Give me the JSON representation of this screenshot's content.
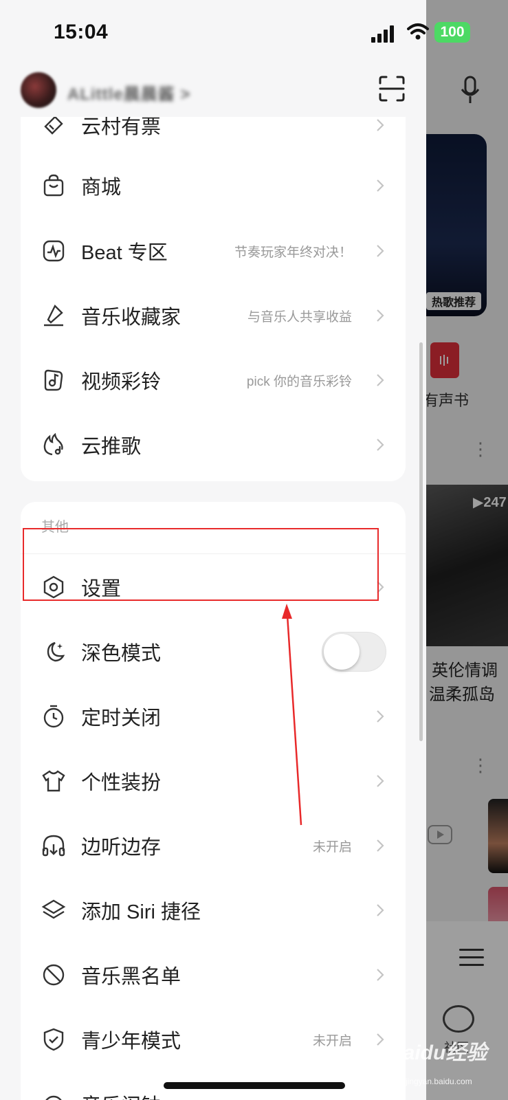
{
  "status_bar": {
    "time": "15:04",
    "battery": "100"
  },
  "header": {
    "username": "ALittle晨晨酱 >"
  },
  "menu_card_1": {
    "items": [
      {
        "label": "云村有票",
        "hint": ""
      },
      {
        "label": "商城",
        "hint": ""
      },
      {
        "label": "Beat 专区",
        "hint": "节奏玩家年终对决！"
      },
      {
        "label": "音乐收藏家",
        "hint": "与音乐人共享收益"
      },
      {
        "label": "视频彩铃",
        "hint": "pick 你的音乐彩铃"
      },
      {
        "label": "云推歌",
        "hint": ""
      }
    ]
  },
  "menu_card_2": {
    "section_title": "其他",
    "items": [
      {
        "label": "设置",
        "hint": ""
      },
      {
        "label": "深色模式",
        "hint": "",
        "toggle": false
      },
      {
        "label": "定时关闭",
        "hint": ""
      },
      {
        "label": "个性装扮",
        "hint": ""
      },
      {
        "label": "边听边存",
        "hint": "未开启"
      },
      {
        "label": "添加 Siri 捷径",
        "hint": ""
      },
      {
        "label": "音乐黑名单",
        "hint": ""
      },
      {
        "label": "青少年模式",
        "hint": "未开启"
      },
      {
        "label": "音乐闹钟",
        "hint": ""
      }
    ]
  },
  "background_app": {
    "banner_badge": "热歌推荐",
    "audiobook_label": "有声书",
    "play_count": "▶247",
    "playlist_title_line1": "英伦情调",
    "playlist_title_line2": "温柔孤岛",
    "community_label": "社区"
  },
  "watermark": {
    "text": "Baidu经验",
    "sub": "jingyan.baidu.com"
  },
  "colors": {
    "highlight": "#e8292a",
    "accent": "#e0303b"
  }
}
